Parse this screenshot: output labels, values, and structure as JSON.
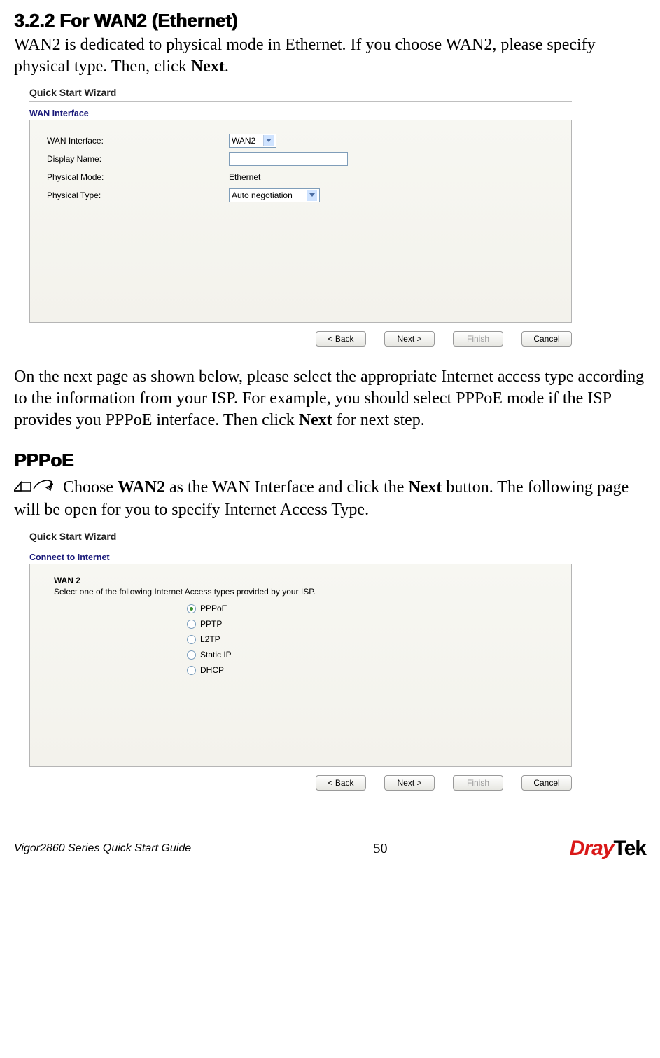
{
  "heading": "3.2.2 For WAN2 (Ethernet)",
  "intro_p1_a": "WAN2 is dedicated to physical mode in Ethernet. If you choose WAN2, please specify physical type. Then, click ",
  "intro_p1_bold": "Next",
  "intro_p1_b": ".",
  "wizard1": {
    "title": "Quick Start Wizard",
    "section": "WAN Interface",
    "rows": {
      "wan_if_label": "WAN Interface:",
      "wan_if_value": "WAN2",
      "disp_name_label": "Display Name:",
      "disp_name_value": "",
      "phys_mode_label": "Physical Mode:",
      "phys_mode_value": "Ethernet",
      "phys_type_label": "Physical Type:",
      "phys_type_value": "Auto negotiation"
    },
    "buttons": {
      "back": "< Back",
      "next": "Next >",
      "finish": "Finish",
      "cancel": "Cancel"
    }
  },
  "mid_p_a": "On the next page as shown below, please select the appropriate Internet access type according to the information from your ISP. For example, you should select PPPoE mode if the ISP provides you PPPoE interface. Then click ",
  "mid_p_bold": "Next",
  "mid_p_b": " for next step.",
  "sub_heading": "PPPoE",
  "note_p_a": "Choose ",
  "note_p_b1": "WAN2",
  "note_p_c": " as the WAN Interface and click the ",
  "note_p_b2": "Next",
  "note_p_d": " button. The following page will be open for you to specify Internet Access Type.",
  "wizard2": {
    "title": "Quick Start Wizard",
    "section": "Connect to Internet",
    "wan_label": "WAN 2",
    "desc": "Select one of the following Internet Access types provided by your ISP.",
    "radios": [
      {
        "label": "PPPoE",
        "checked": true
      },
      {
        "label": "PPTP",
        "checked": false
      },
      {
        "label": "L2TP",
        "checked": false
      },
      {
        "label": "Static IP",
        "checked": false
      },
      {
        "label": "DHCP",
        "checked": false
      }
    ],
    "buttons": {
      "back": "< Back",
      "next": "Next >",
      "finish": "Finish",
      "cancel": "Cancel"
    }
  },
  "footer": {
    "left": "Vigor2860 Series Quick Start Guide",
    "page": "50",
    "logo_a": "Dray",
    "logo_b": "Tek"
  }
}
